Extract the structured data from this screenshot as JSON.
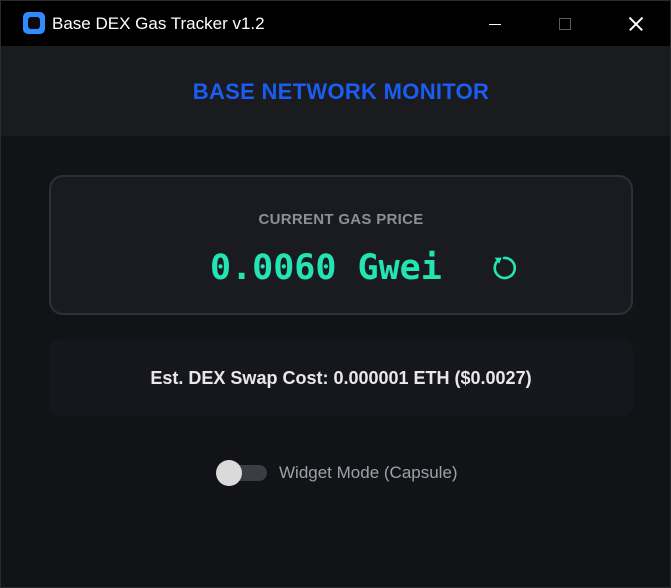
{
  "window": {
    "title": "Base DEX Gas Tracker v1.2",
    "icon": "app-icon",
    "controls": [
      "minimize-icon",
      "maximize-icon",
      "close-icon"
    ]
  },
  "header": {
    "title": "BASE NETWORK MONITOR",
    "title_color": "#1a5df0"
  },
  "gas": {
    "label": "CURRENT GAS PRICE",
    "value": "0.0060 Gwei",
    "value_color": "#23e4b3",
    "refresh_icon": "refresh-icon"
  },
  "swap": {
    "text": "Est. DEX Swap Cost: 0.000001 ETH ($0.0027)"
  },
  "widget_toggle": {
    "label": "Widget Mode (Capsule)",
    "enabled": false
  }
}
